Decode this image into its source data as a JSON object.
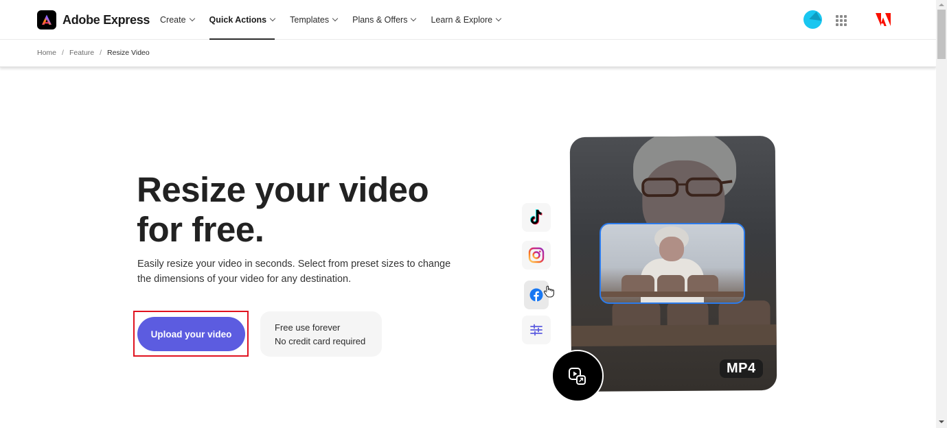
{
  "header": {
    "brand": "Adobe Express",
    "nav": [
      {
        "label": "Create",
        "active": false
      },
      {
        "label": "Quick Actions",
        "active": true
      },
      {
        "label": "Templates",
        "active": false
      },
      {
        "label": "Plans & Offers",
        "active": false
      },
      {
        "label": "Learn & Explore",
        "active": false
      }
    ],
    "icons": {
      "avatar": "user-avatar",
      "apps": "apps-grid-icon",
      "adobe": "adobe-logo-icon"
    }
  },
  "breadcrumb": {
    "items": [
      "Home",
      "Feature",
      "Resize Video"
    ],
    "separator": "/"
  },
  "hero": {
    "title_line1": "Resize your video",
    "title_line2": "for free.",
    "description": "Easily resize your video in seconds. Select from preset sizes to change the dimensions of your video for any destination.",
    "upload_button": "Upload your video",
    "free_line1": "Free use forever",
    "free_line2": "No credit card required"
  },
  "preview": {
    "social_icons": [
      "tiktok-icon",
      "instagram-icon",
      "facebook-icon",
      "adjust-sliders-icon"
    ],
    "format_badge": "MP4",
    "resize_icon": "video-resize-icon"
  },
  "colors": {
    "primary": "#5c5ce0",
    "highlight": "#e0121f",
    "inner_frame": "#2b7bec",
    "adobe_red": "#fa0f00"
  }
}
